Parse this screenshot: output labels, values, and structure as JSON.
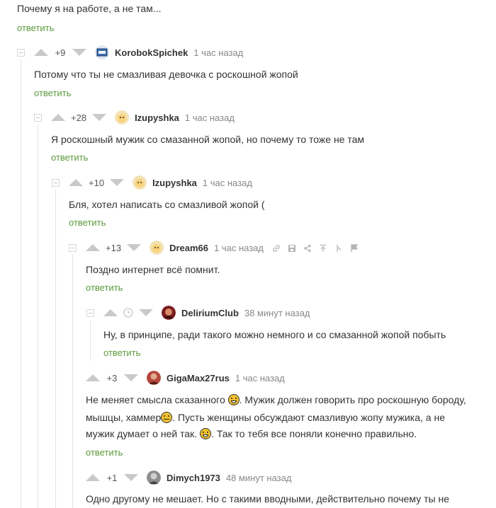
{
  "top": {
    "text": "Почему я на работе, а не там...",
    "reply": "ответить"
  },
  "comments": [
    {
      "rating": "+9",
      "author": "KorobokSpichek",
      "time": "1 час назад",
      "text": "Потому что ты не смазливая девочка с роскошной жопой",
      "reply": "ответить"
    },
    {
      "rating": "+28",
      "author": "Izupyshka",
      "time": "1 час назад",
      "text": "Я роскошный мужик со смазанной жопой, но почему то тоже не там",
      "reply": "ответить"
    },
    {
      "rating": "+10",
      "author": "Izupyshka",
      "time": "1 час назад",
      "text": "Бля, хотел написать со смазливой жопой (",
      "reply": "ответить"
    },
    {
      "rating": "+13",
      "author": "Dream66",
      "time": "1 час назад",
      "text": "Поздно интернет всё помнит.",
      "reply": "ответить"
    },
    {
      "author": "DeliriumClub",
      "time": "38 минут назад",
      "text": "Ну, в принципе, ради такого можно немного и со смазанной жопой побыть",
      "reply": "ответить"
    },
    {
      "rating": "+3",
      "author": "GigaMax27rus",
      "time": "1 час назад",
      "line1a": "Не меняет смысла сказанного",
      "line1b": ". Мужик должен говорить про роскошную бороду,",
      "line2a": "мышцы, хаммер",
      "line2b": ". Пусть женщины обсуждают смазливую жопу мужика, а не",
      "line3a": "мужик думает о ней так.",
      "line3b": ". Так то тебя все поняли конечно правильно.",
      "reply": "ответить"
    },
    {
      "rating": "+1",
      "author": "Dimych1973",
      "time": "48 минут назад",
      "text": "Одно другому не мешает. Но с такими вводными, действительно почему ты не"
    }
  ],
  "colors": {
    "reply_green": "#5b9a3c",
    "vote_gray": "#c9c9c9",
    "thread_line": "#e3e3e3"
  },
  "icons": [
    "arrow-up-icon",
    "arrow-down-icon",
    "clock-icon",
    "link-icon",
    "save-icon",
    "share-icon",
    "jump-up-icon",
    "branch-icon",
    "flag-icon",
    "smile-emoji-icon"
  ]
}
